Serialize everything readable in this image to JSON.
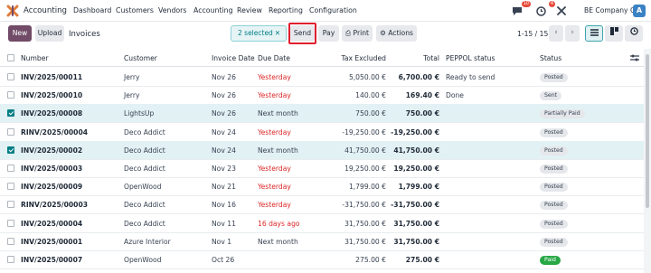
{
  "navbar": {
    "app_name": "Accounting",
    "menu": [
      "Dashboard",
      "Customers",
      "Vendors",
      "Accounting",
      "Review",
      "Reporting",
      "Configuration"
    ],
    "messages_count": "10",
    "activities_count": "4",
    "company": "BE Company CoA",
    "avatar_letter": "A"
  },
  "control": {
    "new_label": "New",
    "upload_label": "Upload",
    "title": "Invoices",
    "selected_label": "2 selected",
    "send_label": "Send",
    "pay_label": "Pay",
    "print_label": "Print",
    "actions_label": "Actions",
    "pager": "1-15 / 15"
  },
  "table": {
    "headers": {
      "number": "Number",
      "customer": "Customer",
      "invoice_date": "Invoice Date",
      "due_date": "Due Date",
      "tax_excluded": "Tax Excluded",
      "total": "Total",
      "peppol": "PEPPOL status",
      "status": "Status"
    },
    "rows": [
      {
        "number": "INV/2025/00011",
        "customer": "Jerry",
        "date": "Nov 26",
        "due": "Yesterday",
        "due_red": true,
        "excl": "5,050.00 €",
        "total": "6,700.00 €",
        "peppol": "Ready to send",
        "status": "Posted",
        "selected": false
      },
      {
        "number": "INV/2025/00010",
        "customer": "Jerry",
        "date": "Nov 26",
        "due": "Yesterday",
        "due_red": true,
        "excl": "140.00 €",
        "total": "169.40 €",
        "peppol": "Done",
        "status": "Sent",
        "selected": false
      },
      {
        "number": "INV/2025/00008",
        "customer": "LightsUp",
        "date": "Nov 26",
        "due": "Next month",
        "due_red": false,
        "excl": "750.00 €",
        "total": "750.00 €",
        "peppol": "",
        "status": "Partially Paid",
        "selected": true
      },
      {
        "number": "RINV/2025/00004",
        "customer": "Deco Addict",
        "date": "Nov 24",
        "due": "Yesterday",
        "due_red": true,
        "excl": "-19,250.00 €",
        "total": "-19,250.00 €",
        "peppol": "",
        "status": "Posted",
        "selected": false
      },
      {
        "number": "INV/2025/00002",
        "customer": "Deco Addict",
        "date": "Nov 24",
        "due": "Next month",
        "due_red": false,
        "excl": "41,750.00 €",
        "total": "41,750.00 €",
        "peppol": "",
        "status": "Posted",
        "selected": true
      },
      {
        "number": "INV/2025/00003",
        "customer": "Deco Addict",
        "date": "Nov 23",
        "due": "Yesterday",
        "due_red": true,
        "excl": "19,250.00 €",
        "total": "19,250.00 €",
        "peppol": "",
        "status": "Posted",
        "selected": false
      },
      {
        "number": "INV/2025/00009",
        "customer": "OpenWood",
        "date": "Nov 21",
        "due": "Yesterday",
        "due_red": true,
        "excl": "1,799.00 €",
        "total": "1,799.00 €",
        "peppol": "",
        "status": "Posted",
        "selected": false
      },
      {
        "number": "RINV/2025/00003",
        "customer": "Deco Addict",
        "date": "Nov 16",
        "due": "Yesterday",
        "due_red": true,
        "excl": "-31,750.00 €",
        "total": "-31,750.00 €",
        "peppol": "",
        "status": "Posted",
        "selected": false
      },
      {
        "number": "INV/2025/00004",
        "customer": "Deco Addict",
        "date": "Nov 11",
        "due": "16 days ago",
        "due_red": true,
        "excl": "31,750.00 €",
        "total": "31,750.00 €",
        "peppol": "",
        "status": "Posted",
        "selected": false
      },
      {
        "number": "INV/2025/00001",
        "customer": "Azure Interior",
        "date": "Nov 1",
        "due": "Next month",
        "due_red": false,
        "excl": "31,750.00 €",
        "total": "31,750.00 €",
        "peppol": "",
        "status": "Posted",
        "selected": false
      },
      {
        "number": "INV/2025/00007",
        "customer": "OpenWood",
        "date": "Oct 26",
        "due": "",
        "due_red": false,
        "excl": "275.00 €",
        "total": "275.00 €",
        "peppol": "",
        "status": "Paid",
        "selected": false
      }
    ]
  },
  "colors": {
    "brand": "#714b67",
    "accent": "#017e84",
    "overdue": "#dc2626",
    "paid": "#28a745",
    "highlight": "#e11d2f"
  }
}
